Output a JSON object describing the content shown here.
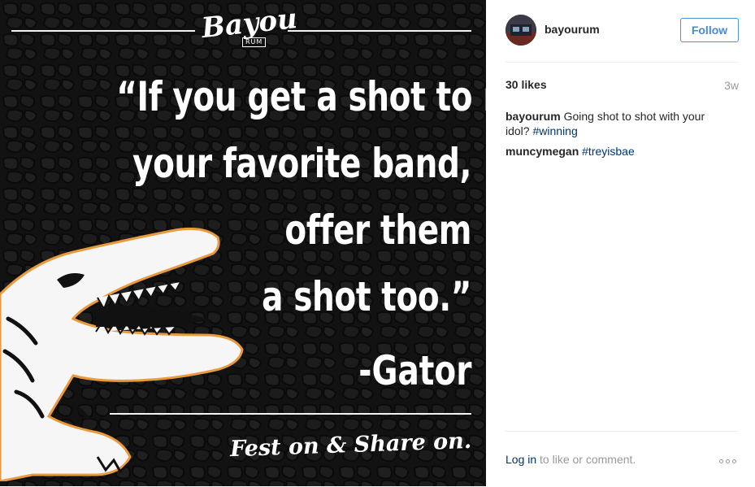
{
  "post_image": {
    "logo_text": "Bayou",
    "logo_sub": "RUM",
    "quote_lines": [
      "“If you get a shot to meet",
      "your favorite band,",
      "offer them",
      "a shot too.”"
    ],
    "attribution": "-Gator",
    "tagline": "Fest on & Share on."
  },
  "header": {
    "username": "bayourum",
    "follow_label": "Follow"
  },
  "stats": {
    "likes": "30 likes",
    "time_ago": "3w"
  },
  "comments": [
    {
      "user": "bayourum",
      "text": "Going shot to shot with your idol?",
      "hashtag": "#winning"
    },
    {
      "user": "muncymegan",
      "text": "",
      "hashtag": "#treyisbae"
    }
  ],
  "footer": {
    "login_link": "Log in",
    "login_rest": "to like or comment."
  },
  "colors": {
    "image_bg": "#131313",
    "link_blue": "#003569",
    "follow_blue": "#4a8ad0",
    "muted_text": "#999999",
    "accent_orange": "#e89a3c"
  },
  "icons": [
    "more-options-icon",
    "gator-illustration",
    "bayou-rum-logo"
  ]
}
